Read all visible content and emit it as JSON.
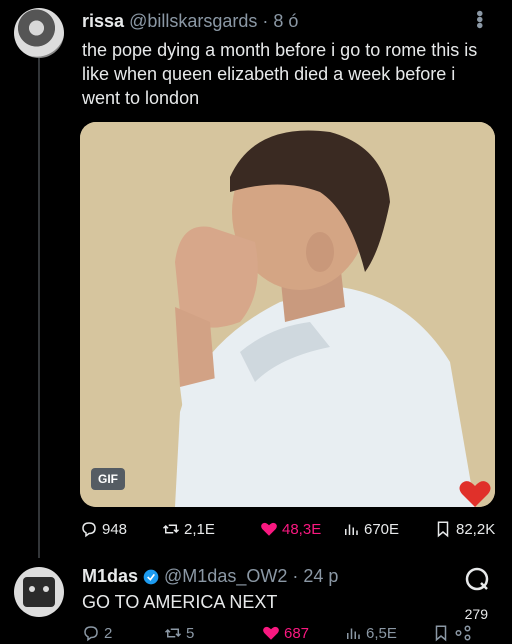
{
  "tweet1": {
    "name": "rissa",
    "handle": "@billskarsgards",
    "time": "· 8 ó",
    "text": "the pope dying a month before i go to rome this is like when queen elizabeth died a week before i went to london",
    "media_badge": "GIF",
    "actions": {
      "replies": "948",
      "retweets": "2,1E",
      "likes": "48,3E",
      "views": "670E",
      "bookmarks": "82,2K"
    }
  },
  "tweet2": {
    "name": "M1das",
    "handle": "@M1das_OW2",
    "time": "· 24 p",
    "text": "GO TO AMERICA NEXT",
    "grok_count": "279",
    "actions": {
      "replies": "2",
      "retweets": "5",
      "likes": "687",
      "views": "6,5E"
    }
  },
  "colors": {
    "like": "#f91880",
    "muted": "#8b98a5",
    "verified": "#1d9bf0"
  }
}
